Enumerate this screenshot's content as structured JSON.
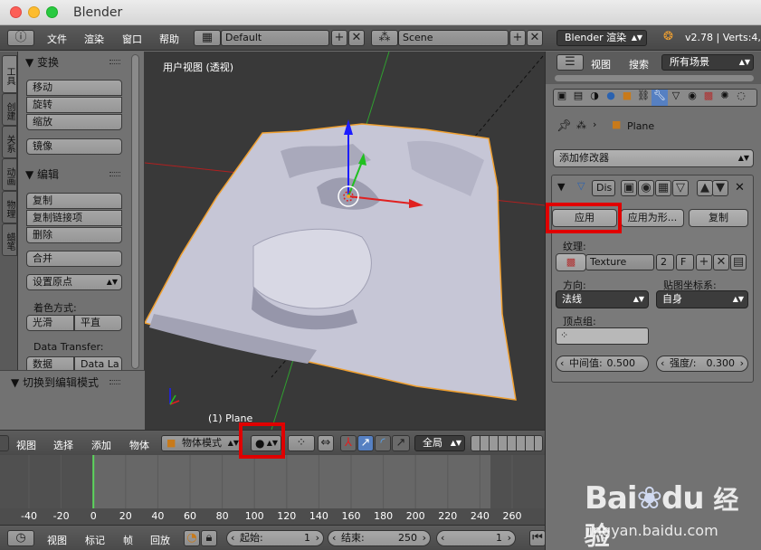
{
  "window": {
    "title": "Blender"
  },
  "info_header": {
    "menus": [
      "文件",
      "渲染",
      "窗口",
      "帮助"
    ],
    "layout": "Default",
    "scene": "Scene",
    "engine": "Blender 渲染",
    "version": "v2.78 | Verts:4,"
  },
  "tool_shelf": {
    "tabs": [
      "工具",
      "创建",
      "关系",
      "动画",
      "物理",
      "蜡笔"
    ],
    "transform_header": "▼ 变换",
    "transform_buttons": [
      "移动",
      "旋转",
      "缩放"
    ],
    "mirror": "镜像",
    "edit_header": "▼ 编辑",
    "edit_buttons": [
      "复制",
      "复制链接项",
      "删除"
    ],
    "join": "合并",
    "set_origin": "设置原点",
    "shading_label": "着色方式:",
    "smooth": "光滑",
    "flat": "平直",
    "data_transfer_label": "Data Transfer:",
    "data": "数据",
    "data_layout": "Data La",
    "toggle_edit": "▼ 切换到编辑模式"
  },
  "viewport": {
    "label": "用户视图 (透视)",
    "object_label": "(1) Plane"
  },
  "viewport_header": {
    "menus": [
      "视图",
      "选择",
      "添加",
      "物体"
    ],
    "mode": "物体模式",
    "orientation": "全局"
  },
  "timeline": {
    "ticks": [
      "-40",
      "-20",
      "0",
      "20",
      "40",
      "60",
      "80",
      "100",
      "120",
      "140",
      "160",
      "180",
      "200",
      "220",
      "240",
      "260"
    ],
    "current_frame": 0,
    "menus": [
      "视图",
      "标记",
      "帧",
      "回放"
    ],
    "start_label": "起始:",
    "start_value": "1",
    "end_label": "结束:",
    "end_value": "250",
    "frame_value": "1"
  },
  "outliner_header": {
    "menus": [
      "视图",
      "搜索"
    ],
    "filter": "所有场景"
  },
  "properties": {
    "object_name": "Plane",
    "add_modifier": "添加修改器",
    "modifier_name": "Dis",
    "apply": "应用",
    "apply_as_shape": "应用为形...",
    "copy": "复制",
    "texture_label": "纹理:",
    "texture_name": "Texture",
    "texture_users": "2",
    "texture_fake": "F",
    "direction_label": "方向:",
    "direction_value": "法线",
    "coords_label": "贴图坐标系:",
    "coords_value": "自身",
    "vgroup_label": "顶点组:",
    "midlevel_label": "中间值:",
    "midlevel_value": "0.500",
    "strength_label": "强度/:",
    "strength_value": "0.300"
  },
  "watermark": {
    "brand_prefix": "Bai",
    "brand_suffix": "du",
    "brand_cn": "经验",
    "url": "jingyan.baidu.com"
  },
  "colors": {
    "highlight": "#e00000",
    "axis_x": "#e02020",
    "axis_y": "#20c020",
    "axis_z": "#1020e0",
    "terrain": "#c9c9d8",
    "selected_outline": "#f0a030"
  }
}
